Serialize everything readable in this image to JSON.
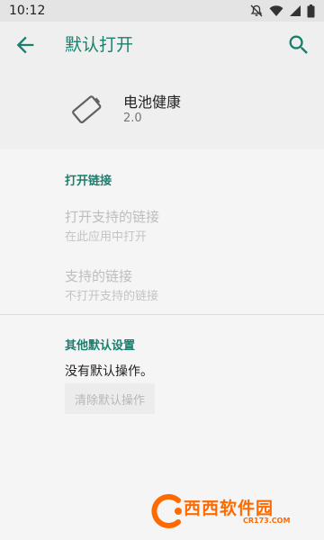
{
  "status_bar": {
    "time": "10:12",
    "icons": [
      "dnd-off-icon",
      "wifi-icon",
      "signal-icon",
      "battery-icon"
    ]
  },
  "app_bar": {
    "title": "默认打开",
    "back_icon": "arrow-back-icon",
    "search_icon": "search-icon",
    "accent_color": "#1a7f6d"
  },
  "app_info": {
    "name": "电池健康",
    "version": "2.0",
    "icon": "battery-outline-icon"
  },
  "sections": {
    "open_links": {
      "title": "打开链接",
      "items": [
        {
          "title": "打开支持的链接",
          "summary": "在此应用中打开"
        },
        {
          "title": "支持的链接",
          "summary": "不打开支持的链接"
        }
      ]
    },
    "defaults": {
      "title": "其他默认设置",
      "message": "没有默认操作。",
      "clear_button": "清除默认操作"
    }
  },
  "watermark": {
    "brand": "西西软件园",
    "url": "CR173.COM"
  }
}
